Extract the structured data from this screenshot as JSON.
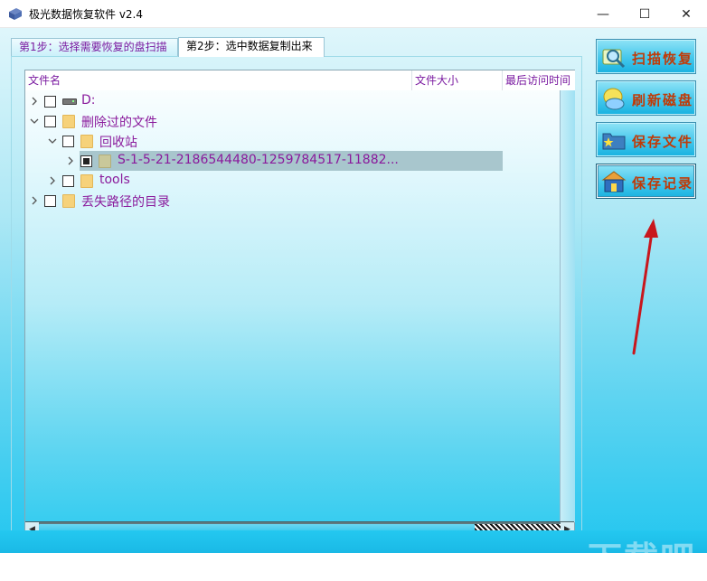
{
  "window": {
    "title": "极光数据恢复软件 v2.4",
    "minimize_glyph": "—",
    "maximize_glyph": "☐",
    "close_glyph": "✕"
  },
  "tabs": [
    {
      "label": "第1步：选择需要恢复的盘扫描",
      "active": false
    },
    {
      "label": "第2步：选中数据复制出来",
      "active": true
    }
  ],
  "tree": {
    "columns": [
      "文件名",
      "文件大小",
      "最后访问时间"
    ],
    "rows": [
      {
        "label": "D:",
        "icon": "drive-icon",
        "expanded": false,
        "checked": false
      },
      {
        "label": "删除过的文件",
        "icon": "folder-icon",
        "expanded": true,
        "checked": false
      },
      {
        "label": "回收站",
        "icon": "folder-icon",
        "expanded": true,
        "checked": false
      },
      {
        "label": "S-1-5-21-2186544480-1259784517-11882...",
        "icon": "folder-icon",
        "expanded": false,
        "checked": "partial",
        "selected": true
      },
      {
        "label": "tools",
        "icon": "folder-icon",
        "expanded": false,
        "checked": false
      },
      {
        "label": "丢失路径的目录",
        "icon": "folder-icon",
        "expanded": false,
        "checked": false
      }
    ]
  },
  "side_buttons": [
    {
      "label": "扫描恢复",
      "icon": "scan-magnifier-icon"
    },
    {
      "label": "刷新磁盘",
      "icon": "refresh-disk-icon"
    },
    {
      "label": "保存文件",
      "icon": "save-file-icon"
    },
    {
      "label": "保存记录",
      "icon": "save-record-icon"
    }
  ],
  "watermark": {
    "text": "下载吧",
    "url": "www.xiazaiba.com"
  },
  "colors": {
    "label_purple": "#8a1a9c",
    "button_text": "#c03a07",
    "arrow_red": "#c8171d"
  }
}
